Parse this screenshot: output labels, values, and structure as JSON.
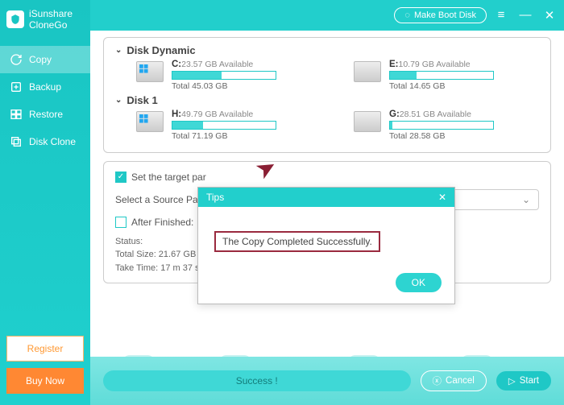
{
  "brand": {
    "line1": "iSunshare",
    "line2": "CloneGo"
  },
  "titlebar": {
    "make_boot": "Make Boot Disk"
  },
  "nav": {
    "copy": "Copy",
    "backup": "Backup",
    "restore": "Restore",
    "diskclone": "Disk Clone"
  },
  "buttons": {
    "register": "Register",
    "buy": "Buy Now"
  },
  "disks": {
    "dynamic": {
      "title": "Disk Dynamic",
      "c": {
        "letter": "C:",
        "avail": "23.57 GB Available",
        "total": "Total 45.03 GB",
        "fill": 48
      },
      "e": {
        "letter": "E:",
        "avail": "10.79 GB Available",
        "total": "Total 14.65 GB",
        "fill": 26
      }
    },
    "disk1": {
      "title": "Disk 1",
      "h": {
        "letter": "H:",
        "avail": "49.79 GB Available",
        "total": "Total 71.19 GB",
        "fill": 30
      },
      "g": {
        "letter": "G:",
        "avail": "28.51 GB Available",
        "total": "Total 28.58 GB",
        "fill": 2
      }
    }
  },
  "options": {
    "set_target": "Set the target par",
    "select_source": "Select a Source Part",
    "after_finished": "After Finished:"
  },
  "status": {
    "label": "Status:",
    "size": "Total Size: 21.67 GB",
    "time": "Take Time: 17 m 37 s"
  },
  "footer": {
    "progress": "Success !",
    "cancel": "Cancel",
    "start": "Start"
  },
  "dialog": {
    "title": "Tips",
    "message": "The Copy Completed Successfully.",
    "ok": "OK"
  }
}
